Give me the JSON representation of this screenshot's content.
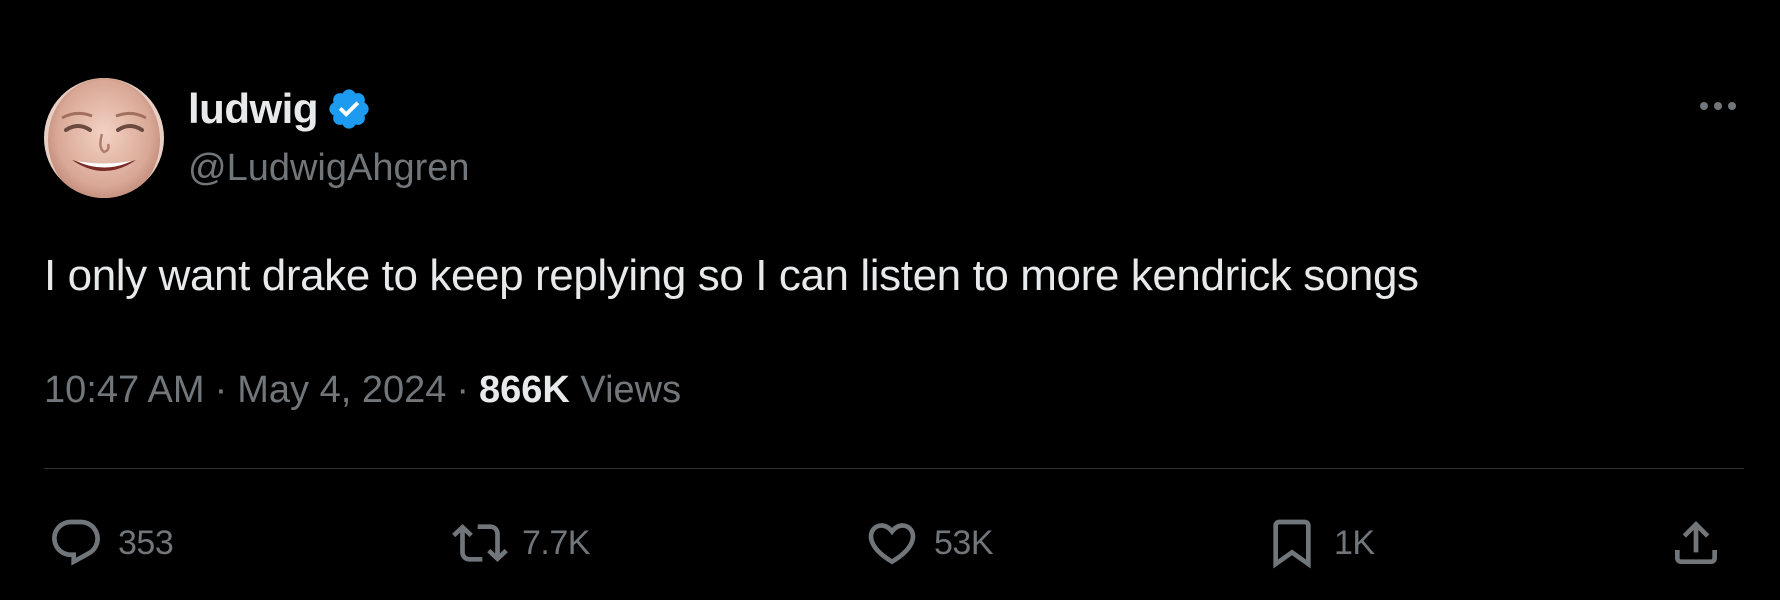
{
  "author": {
    "display_name": "ludwig",
    "handle": "@LudwigAhgren",
    "verified": true,
    "verified_color": "#1d9bf0"
  },
  "tweet": {
    "text": "I only want drake to keep replying so I can listen to more kendrick songs"
  },
  "meta": {
    "time": "10:47 AM",
    "date": "May 4, 2024",
    "views_count": "866K",
    "views_label": "Views",
    "separator": "·"
  },
  "actions": {
    "replies": "353",
    "reposts": "7.7K",
    "likes": "53K",
    "bookmarks": "1K"
  },
  "icons": {
    "more": "more-icon",
    "reply": "reply-icon",
    "repost": "repost-icon",
    "like": "heart-icon",
    "bookmark": "bookmark-icon",
    "share": "share-icon",
    "verified": "verified-badge-icon"
  },
  "colors": {
    "background": "#000000",
    "primary_text": "#e7e9ea",
    "secondary_text": "#71767b",
    "divider": "#2f3336"
  }
}
